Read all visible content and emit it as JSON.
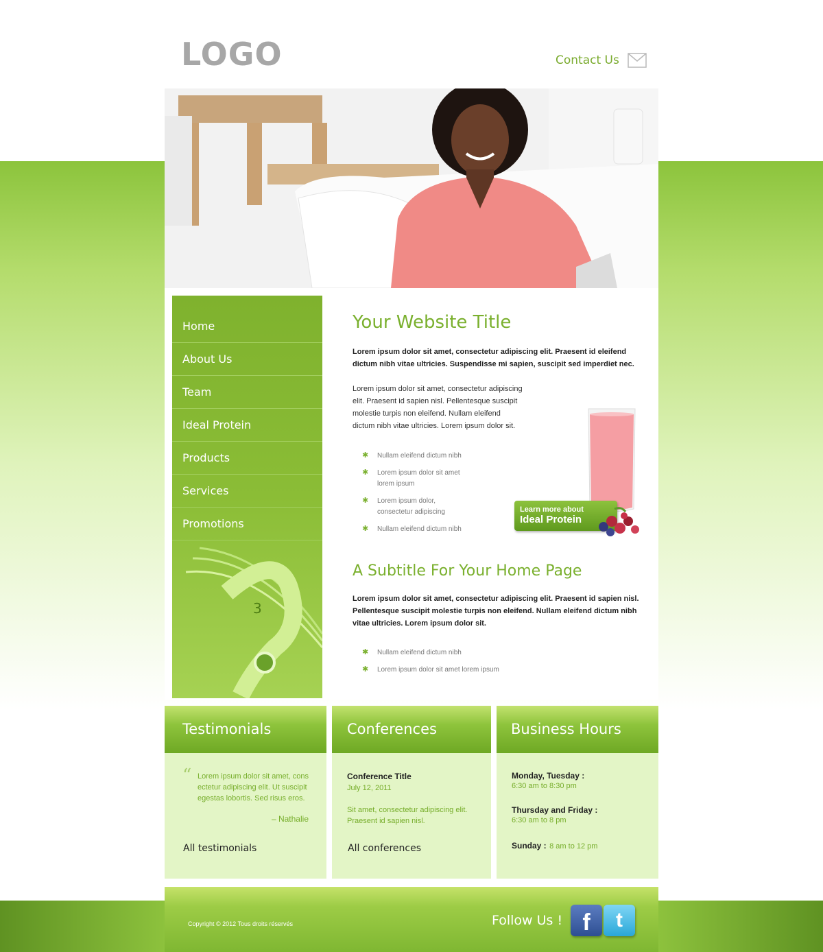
{
  "header": {
    "logo": "LOGO",
    "contact": "Contact Us"
  },
  "nav": {
    "items": [
      "Home",
      "About Us",
      "Team",
      "Ideal Protein",
      "Products",
      "Services",
      "Promotions"
    ]
  },
  "main": {
    "title": "Your Website Title",
    "lead": "Lorem ipsum dolor sit amet, consectetur adipiscing elit. Praesent id eleifend dictum nibh vitae ultricies. Suspendisse mi sapien, suscipit sed imperdiet nec.",
    "paragraph": "Lorem ipsum dolor sit amet, consectetur adipiscing elit. Praesent id sapien nisl. Pellentesque suscipit molestie turpis non eleifend. Nullam eleifend dictum nibh vitae ultricies. Lorem ipsum dolor sit.",
    "bullets": [
      "Nullam eleifend dictum nibh",
      "Lorem ipsum dolor sit amet lorem ipsum",
      "Lorem ipsum dolor, consectetur adipiscing",
      "Nullam eleifend dictum nibh"
    ],
    "promo_line1": "Learn more about",
    "promo_line2": "Ideal Protein",
    "subtitle": "A Subtitle For Your Home Page",
    "lead2": "Lorem ipsum dolor sit amet, consectetur adipiscing elit. Praesent id sapien nisl. Pellentesque suscipit molestie turpis non eleifend. Nullam eleifend dictum nibh vitae ultricies. Lorem ipsum dolor sit.",
    "bullets2": [
      "Nullam eleifend dictum nibh",
      "Lorem ipsum dolor sit amet lorem ipsum"
    ]
  },
  "testimonials": {
    "heading": "Testimonials",
    "quote": "Lorem ipsum dolor sit amet, cons ectetur adipiscing elit. Ut suscipit egestas lobortis. Sed risus eros.",
    "author": "– Nathalie",
    "link": "All testimonials"
  },
  "conferences": {
    "heading": "Conferences",
    "title": "Conference Title",
    "date": "July 12, 2011",
    "text": "Sit amet, consectetur adipiscing elit. Praesent id sapien nisl.",
    "link": "All conferences"
  },
  "hours": {
    "heading": "Business Hours",
    "day1": "Monday, Tuesday :",
    "time1": "6:30 am to 8:30 pm",
    "day2": "Thursday and Friday :",
    "time2": "6:30 am to 8 pm",
    "day3": "Sunday :",
    "time3": "8 am to 12 pm"
  },
  "footer": {
    "copyright": "Copyright © 2012 Tous droits réservés",
    "follow": "Follow Us !"
  },
  "colors": {
    "accent": "#7ab02e",
    "nav_bg": "#8bbd36",
    "box_bg": "#e3f5c6"
  }
}
